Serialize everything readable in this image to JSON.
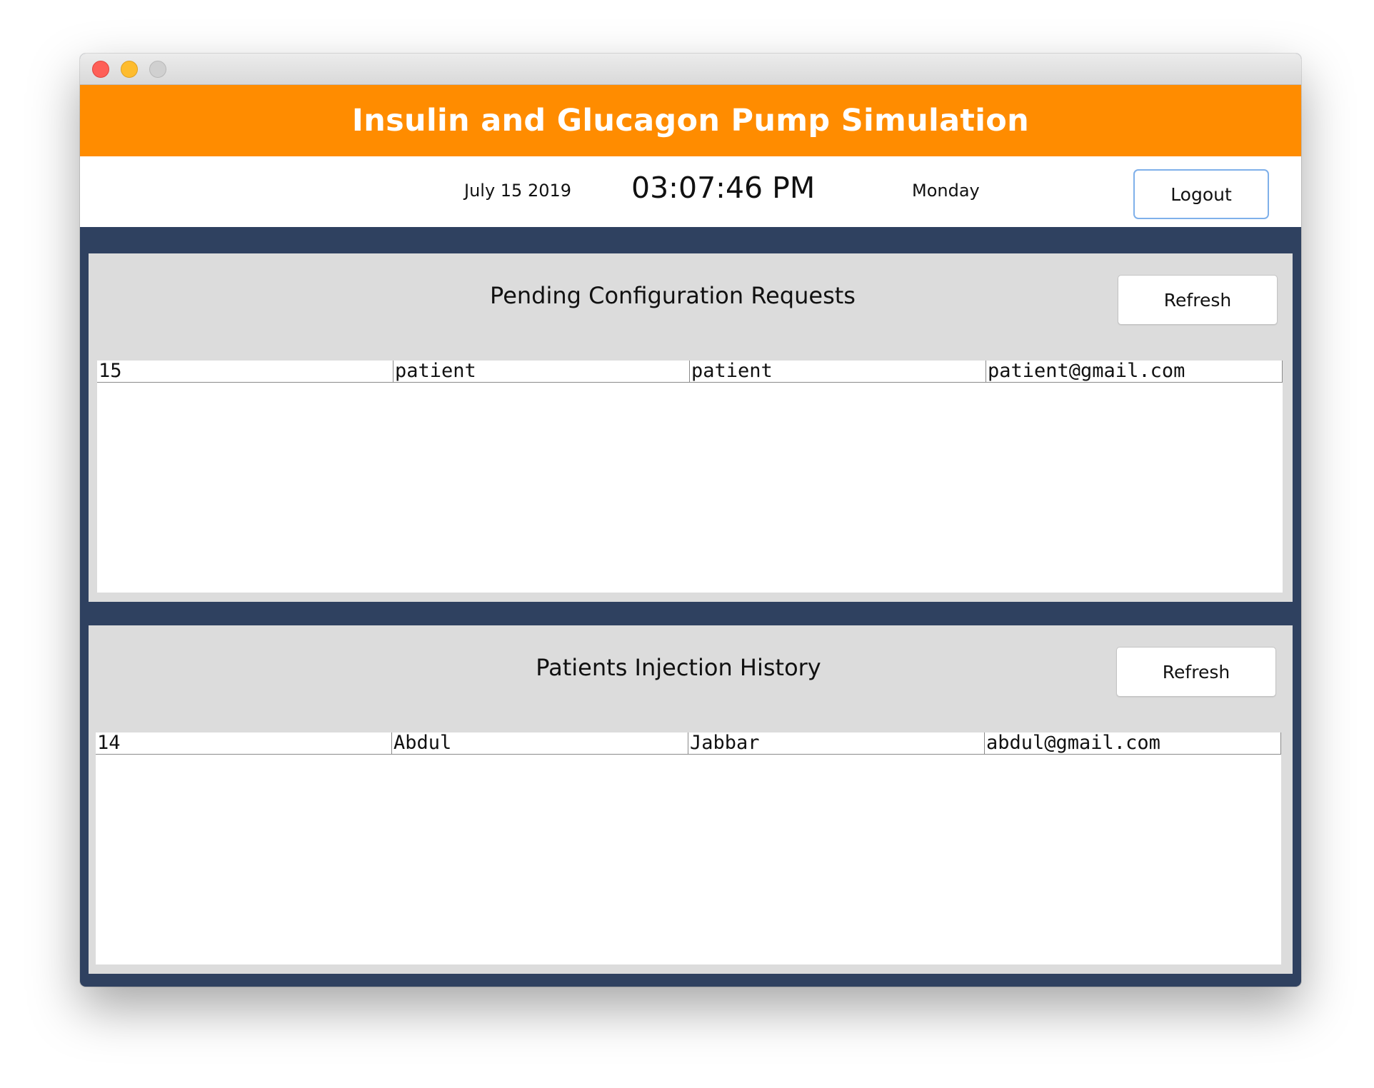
{
  "header": {
    "title": "Insulin and Glucagon Pump Simulation"
  },
  "info": {
    "date": "July 15 2019",
    "time": "03:07:46 PM",
    "day": "Monday",
    "logout_label": "Logout"
  },
  "pending": {
    "title": "Pending Configuration Requests",
    "refresh_label": "Refresh",
    "rows": [
      [
        "15",
        "patient",
        "patient",
        "patient@gmail.com"
      ]
    ]
  },
  "history": {
    "title": "Patients Injection History",
    "refresh_label": "Refresh",
    "rows": [
      [
        "14",
        "Abdul",
        "Jabbar",
        "abdul@gmail.com"
      ]
    ]
  },
  "colors": {
    "header_bg": "#ff8c00",
    "window_bg": "#2f4160",
    "panel_bg": "#dcdcdc"
  }
}
